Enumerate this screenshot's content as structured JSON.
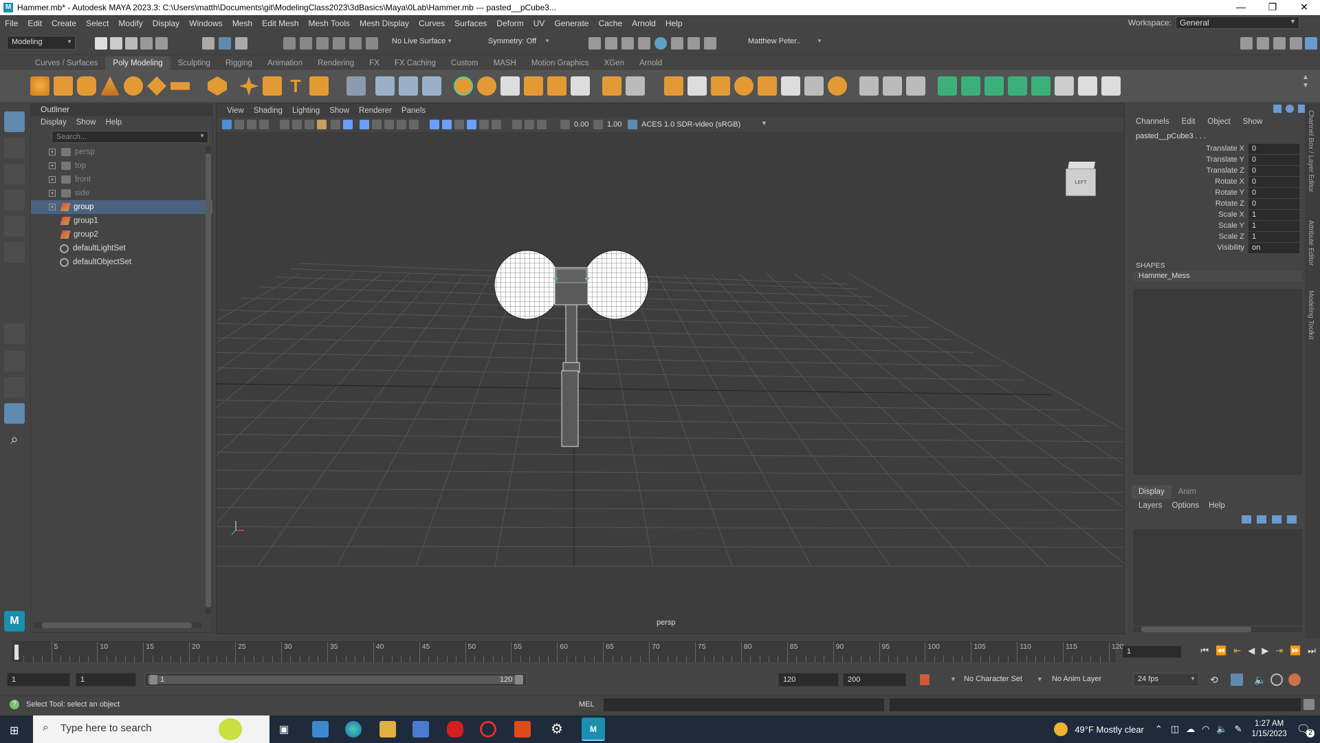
{
  "window": {
    "title": "Hammer.mb* - Autodesk MAYA 2023.3: C:\\Users\\matth\\Documents\\git\\ModelingClass2023\\3dBasics\\Maya\\0Lab\\Hammer.mb  ---  pasted__pCube3...",
    "minimize": "—",
    "maximize": "❐",
    "close": "✕"
  },
  "menubar": {
    "items": [
      "File",
      "Edit",
      "Create",
      "Select",
      "Modify",
      "Display",
      "Windows",
      "Mesh",
      "Edit Mesh",
      "Mesh Tools",
      "Mesh Display",
      "Curves",
      "Surfaces",
      "Deform",
      "UV",
      "Generate",
      "Cache",
      "Arnold",
      "Help"
    ],
    "workspace_label": "Workspace:",
    "workspace_value": "General"
  },
  "statusline": {
    "menuset": "Modeling",
    "live_surface": "No Live Surface",
    "symmetry": "Symmetry: Off",
    "user": "Matthew Peter.."
  },
  "shelf": {
    "tabs": [
      "Curves / Surfaces",
      "Poly Modeling",
      "Sculpting",
      "Rigging",
      "Animation",
      "Rendering",
      "FX",
      "FX Caching",
      "Custom",
      "MASH",
      "Motion Graphics",
      "XGen",
      "Arnold"
    ],
    "active_tab": "Poly Modeling"
  },
  "outliner": {
    "title": "Outliner",
    "menu": [
      "Display",
      "Show",
      "Help"
    ],
    "search_placeholder": "Search...",
    "items": [
      {
        "label": "persp",
        "kind": "camera"
      },
      {
        "label": "top",
        "kind": "camera"
      },
      {
        "label": "front",
        "kind": "camera"
      },
      {
        "label": "side",
        "kind": "camera"
      },
      {
        "label": "group",
        "kind": "group",
        "selected": true
      },
      {
        "label": "group1",
        "kind": "group"
      },
      {
        "label": "group2",
        "kind": "group"
      },
      {
        "label": "defaultLightSet",
        "kind": "set"
      },
      {
        "label": "defaultObjectSet",
        "kind": "set"
      }
    ]
  },
  "viewport": {
    "menu": [
      "View",
      "Shading",
      "Lighting",
      "Show",
      "Renderer",
      "Panels"
    ],
    "exposure": "0.00",
    "gamma": "1.00",
    "color_space": "ACES 1.0 SDR-video (sRGB)",
    "camera_label": "persp",
    "viewcube_face": "LEFT"
  },
  "channelbox": {
    "menu": [
      "Channels",
      "Edit",
      "Object",
      "Show"
    ],
    "object_name": "pasted__pCube3 . . .",
    "attributes": [
      {
        "name": "Translate X",
        "value": "0"
      },
      {
        "name": "Translate Y",
        "value": "0"
      },
      {
        "name": "Translate Z",
        "value": "0"
      },
      {
        "name": "Rotate X",
        "value": "0"
      },
      {
        "name": "Rotate Y",
        "value": "0"
      },
      {
        "name": "Rotate Z",
        "value": "0"
      },
      {
        "name": "Scale X",
        "value": "1"
      },
      {
        "name": "Scale Y",
        "value": "1"
      },
      {
        "name": "Scale Z",
        "value": "1"
      },
      {
        "name": "Visibility",
        "value": "on"
      }
    ],
    "shapes_header": "SHAPES",
    "shape_name": "Hammer_Mess"
  },
  "layereditor": {
    "tabs": [
      "Display",
      "Anim"
    ],
    "menu": [
      "Layers",
      "Options",
      "Help"
    ]
  },
  "sidetabs": [
    "Channel Box / Layer Editor",
    "Attribute Editor",
    "Modeling Toolkit"
  ],
  "timeline": {
    "ticks": [
      "5",
      "10",
      "15",
      "20",
      "25",
      "30",
      "35",
      "40",
      "45",
      "50",
      "55",
      "60",
      "65",
      "70",
      "75",
      "80",
      "85",
      "90",
      "95",
      "100",
      "105",
      "110",
      "115",
      "120"
    ],
    "start_tick": "1",
    "current_frame": "1"
  },
  "range": {
    "start": "1",
    "playback_start": "1",
    "slider_start": "1",
    "slider_end": "120",
    "playback_end": "120",
    "end": "200",
    "character_set": "No Character Set",
    "anim_layer": "No Anim Layer",
    "fps": "24 fps"
  },
  "cmdline": {
    "help_text": "Select Tool: select an object",
    "mode": "MEL"
  },
  "taskbar": {
    "search_placeholder": "Type here to search",
    "weather": "49°F  Mostly clear",
    "time": "1:27 AM",
    "date": "1/15/2023",
    "notif_count": "2"
  }
}
